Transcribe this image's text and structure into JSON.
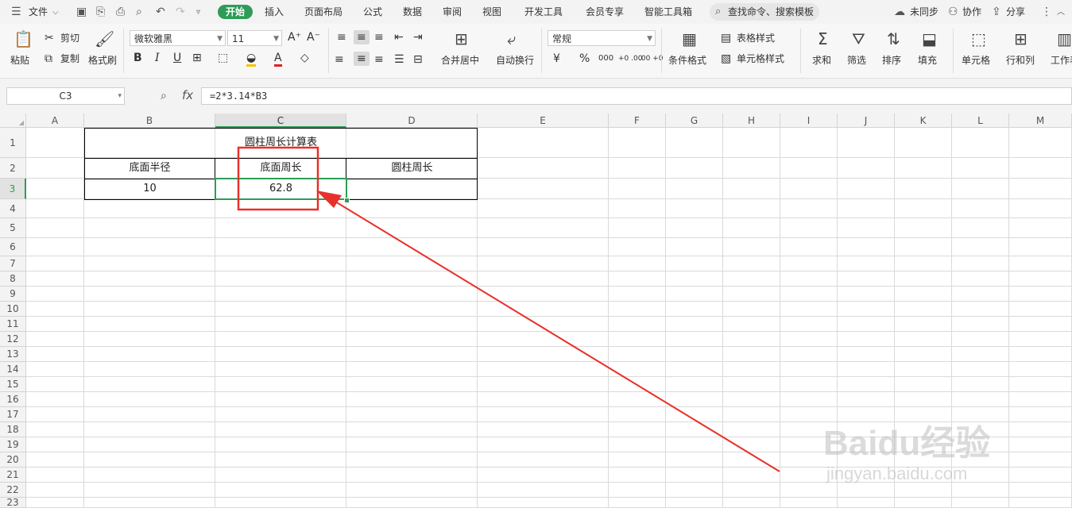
{
  "menubar": {
    "file": "文件",
    "tabs": [
      "开始",
      "插入",
      "页面布局",
      "公式",
      "数据",
      "审阅",
      "视图",
      "开发工具",
      "会员专享",
      "智能工具箱"
    ],
    "search": "查找命令、搜索模板",
    "right": [
      "未同步",
      "协作",
      "分享"
    ]
  },
  "ribbon": {
    "paste": "粘贴",
    "cut": "剪切",
    "copy": "复制",
    "format_painter": "格式刷",
    "font_name": "微软雅黑",
    "font_size": "11",
    "bold": "B",
    "italic": "I",
    "underline": "U",
    "merge_center": "合并居中",
    "wrap_text": "自动换行",
    "number_format": "常规",
    "currency": "¥",
    "percent": "%",
    "thousands": "000",
    "inc_decimal": "+0 .00",
    "dec_decimal": ".00 +0",
    "cond_format": "条件格式",
    "table_style": "表格样式",
    "cell_style": "单元格样式",
    "sum": "求和",
    "filter": "筛选",
    "sort": "排序",
    "fill": "填充",
    "cell": "单元格",
    "row_col": "行和列",
    "worksheet": "工作表"
  },
  "formula_bar": {
    "cell_ref": "C3",
    "fx": "fx",
    "formula": "=2*3.14*B3"
  },
  "sheet": {
    "columns": [
      "A",
      "B",
      "C",
      "D",
      "E",
      "F",
      "G",
      "H",
      "I",
      "J",
      "K",
      "L",
      "M"
    ],
    "rows": [
      "1",
      "2",
      "3",
      "4",
      "5",
      "6",
      "7",
      "8",
      "9",
      "10",
      "11",
      "12",
      "13",
      "14",
      "15",
      "16",
      "17",
      "18",
      "19",
      "20",
      "21",
      "22",
      "23"
    ],
    "selected_cell": "C3",
    "title": "圆柱周长计算表",
    "headers": [
      "底面半径",
      "底面周长",
      "圆柱周长"
    ],
    "values": [
      "10",
      "62.8",
      ""
    ]
  },
  "watermark": {
    "brand": "Baidu经验",
    "url": "jingyan.baidu.com"
  },
  "colors": {
    "accent": "#2e9c56",
    "annotation": "#e8302a"
  }
}
